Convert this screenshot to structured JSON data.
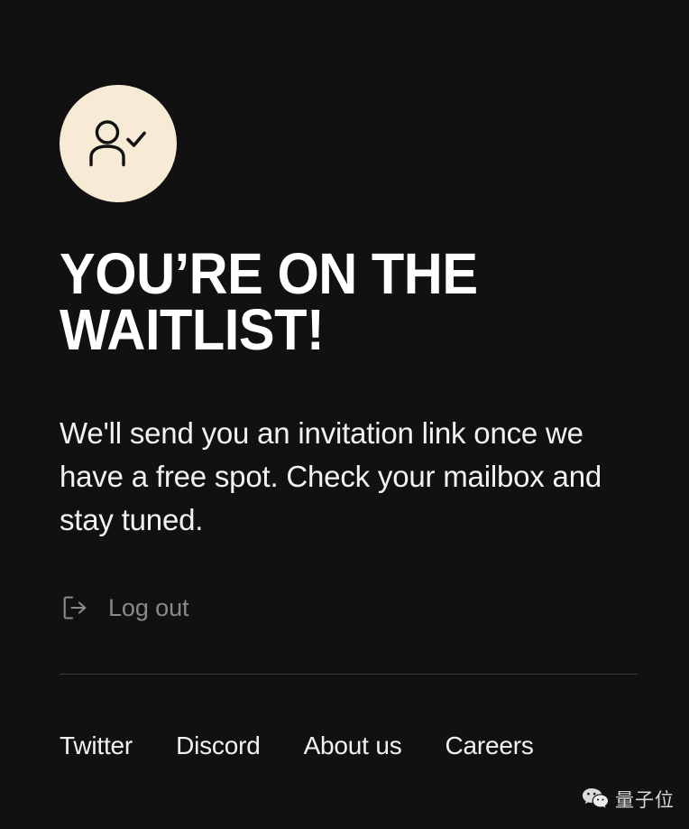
{
  "theme": {
    "background": "#111111",
    "accent_circle": "#F7EBD6",
    "icon_stroke": "#111111",
    "text_primary": "#FFFFFF",
    "text_body": "#F2F2F2",
    "text_muted": "#8A8A8A",
    "divider": "#3A3A3A"
  },
  "status_badge": {
    "icon": "user-check-icon"
  },
  "headline": {
    "text": "YOU’RE ON THE\nWAITLIST!"
  },
  "body": {
    "text": "We'll send you an invitation link once we have a free spot. Check your mailbox and stay tuned."
  },
  "logout": {
    "icon": "logout-icon",
    "label": "Log out"
  },
  "footer": {
    "links": [
      {
        "label": "Twitter"
      },
      {
        "label": "Discord"
      },
      {
        "label": "About us"
      },
      {
        "label": "Careers"
      }
    ]
  },
  "watermark": {
    "icon": "wechat-icon",
    "label": "量子位"
  }
}
